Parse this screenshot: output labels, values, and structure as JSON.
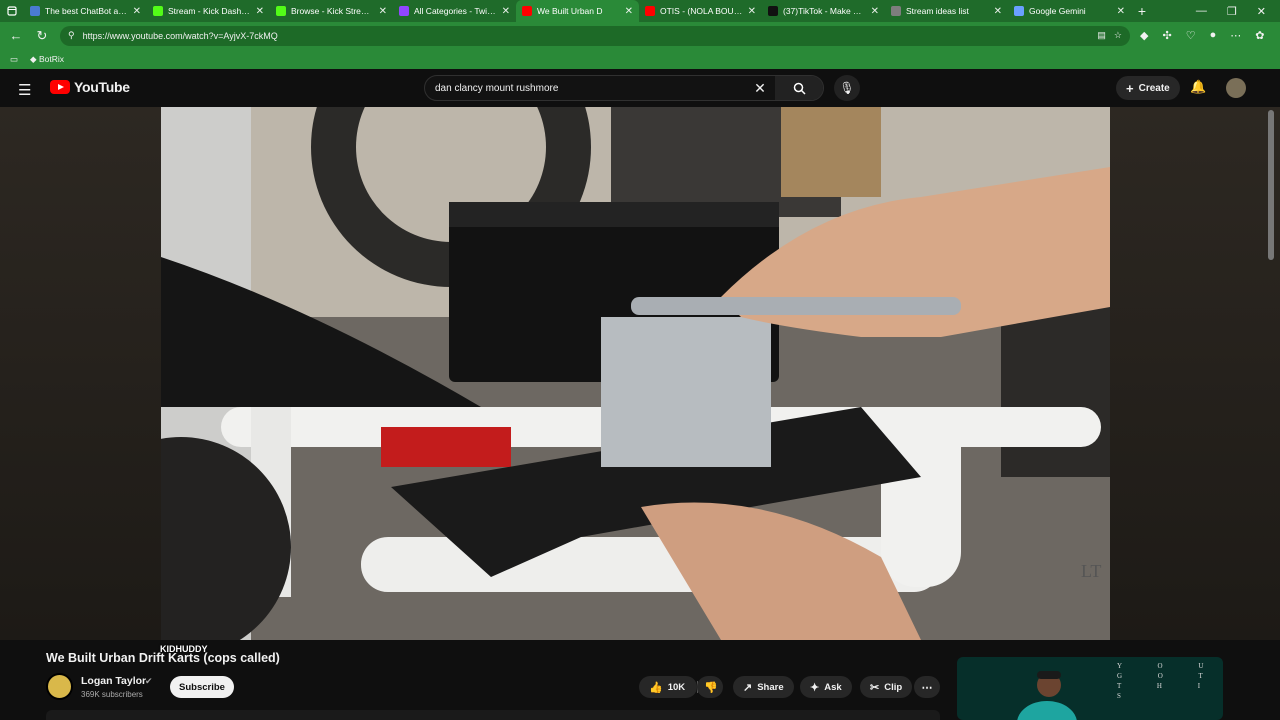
{
  "browser": {
    "tabs": [
      {
        "title": "The best ChatBot and ",
        "color": "#4a7bd1"
      },
      {
        "title": "Stream - Kick Dashboar",
        "color": "#53fc18"
      },
      {
        "title": "Browse - Kick Streamin",
        "color": "#53fc18"
      },
      {
        "title": "All Categories - Twitch",
        "color": "#9146ff"
      },
      {
        "title": "We Built Urban D",
        "color": "#ff0000"
      },
      {
        "title": "OTIS - (NOLA BOUNCE",
        "color": "#ff0000"
      },
      {
        "title": "(37)TikTok - Make Your",
        "color": "#111111"
      },
      {
        "title": "Stream ideas list",
        "color": "#7e7e7e"
      },
      {
        "title": "Google Gemini",
        "color": "#6aa0ff"
      }
    ],
    "url": "https://www.youtube.com/watch?v=AyjvX-7ckMQ",
    "bookmark": "BotRix"
  },
  "youtube": {
    "logo_text": "YouTube",
    "search_query": "dan clancy mount rushmore",
    "create_label": "Create",
    "video": {
      "title": "We Built Urban Drift Karts (cops called)",
      "overlay_tag": "KIDHUDDY",
      "channel": "Logan Taylor",
      "subscribers": "369K subscribers",
      "subscribe_label": "Subscribe",
      "like_count": "10K",
      "share_label": "Share",
      "ask_label": "Ask",
      "clip_label": "Clip",
      "watermark": "LT"
    },
    "ad_letters": "Y O U G O T T H I S"
  }
}
